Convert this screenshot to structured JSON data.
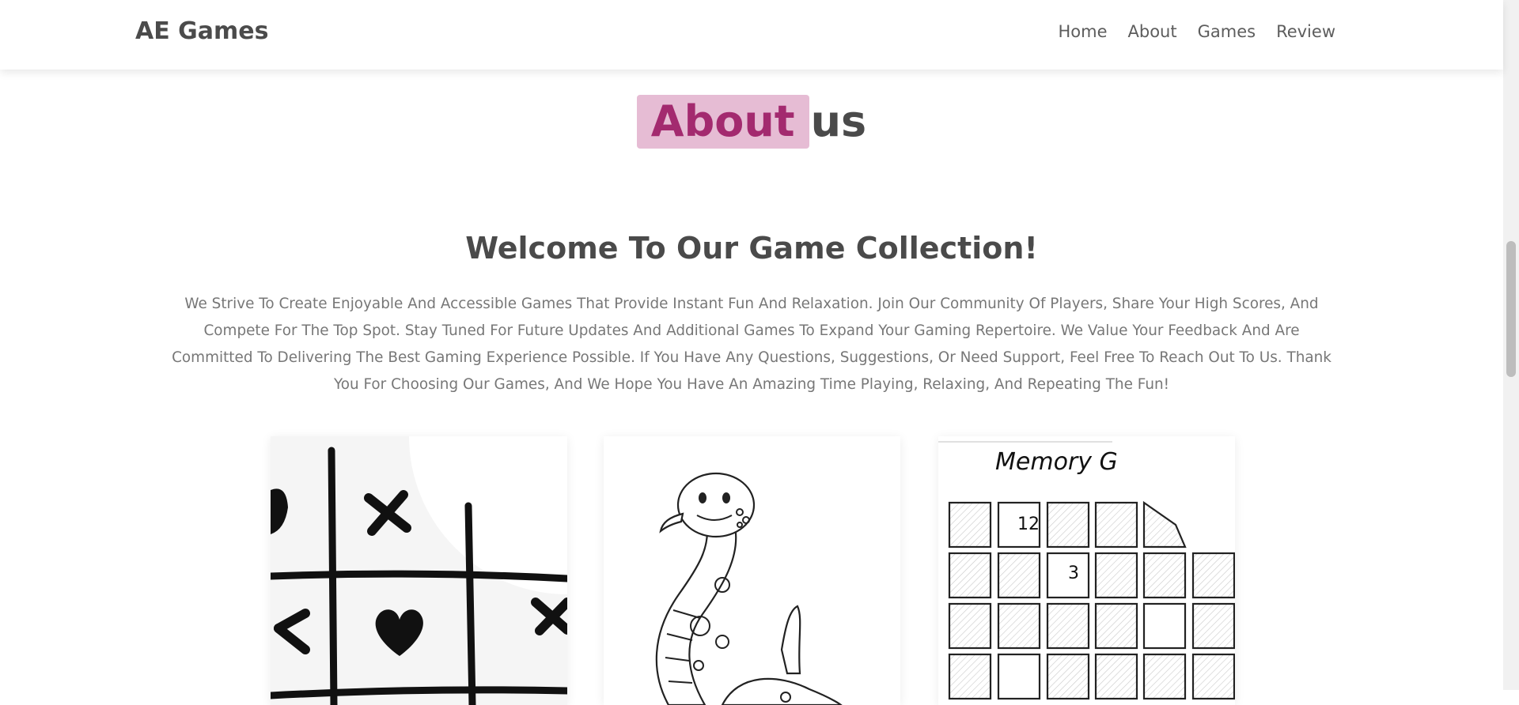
{
  "header": {
    "logo": "AE Games",
    "nav": [
      "Home",
      "About",
      "Games",
      "Review"
    ]
  },
  "about": {
    "highlight": "About",
    "rest": "us"
  },
  "welcome": "Welcome To Our Game Collection!",
  "paragraph": "We Strive To Create Enjoyable And Accessible Games That Provide Instant Fun And Relaxation. Join Our Community Of Players, Share Your High Scores, And Compete For The Top Spot. Stay Tuned For Future Updates And Additional Games To Expand Your Gaming Repertoire. We Value Your Feedback And Are Committed To Delivering The Best Gaming Experience Possible. If You Have Any Questions, Suggestions, Or Need Support, Feel Free To Reach Out To Us. Thank You For Choosing Our Games, And We Hope You Have An Amazing Time Playing, Relaxing, And Repeating The Fun!",
  "cards": [
    {
      "image": "tic-tac-toe-illustration"
    },
    {
      "image": "snake-illustration"
    },
    {
      "image": "memory-game-illustration",
      "title": "Memory G",
      "tiles": [
        "12",
        "3"
      ]
    }
  ],
  "colors": {
    "highlight_bg": "#e6bcd4",
    "highlight_text": "#a32a6f",
    "text": "#4a4a4a"
  }
}
